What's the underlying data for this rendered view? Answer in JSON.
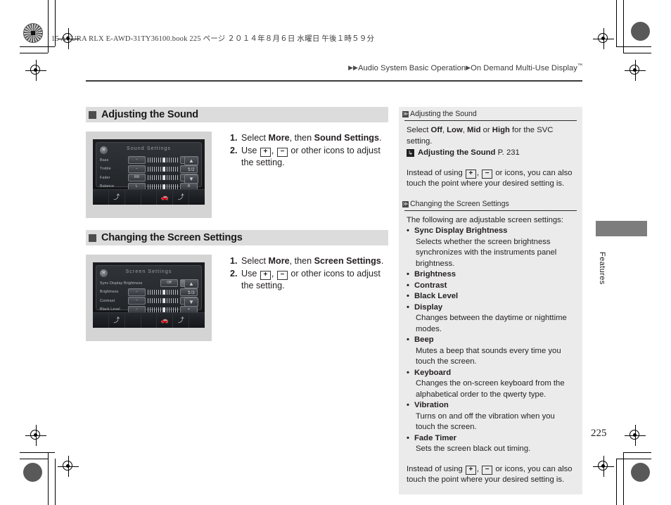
{
  "print_marks": {
    "slugline": "15 ACURA RLX E-AWD-31TY36100.book  225 ページ  ２０１４年８月６日  水曜日  午後１時５９分"
  },
  "header": {
    "breadcrumb_arrow": "▶▶",
    "breadcrumb_1": "Audio System Basic Operation",
    "breadcrumb_sep": "▶",
    "breadcrumb_2": "On Demand Multi-Use Display",
    "trademark": "™"
  },
  "sections": [
    {
      "heading": "Adjusting the Sound",
      "screenshot": {
        "title": "Sound Settings",
        "close_glyph": "✕",
        "page_indicator": "1/2",
        "up_glyph": "▲",
        "down_glyph": "▼",
        "rows": [
          {
            "label": "Bass",
            "left": "−",
            "right": "+",
            "knob": 50
          },
          {
            "label": "Treble",
            "left": "−",
            "right": "+",
            "knob": 50
          },
          {
            "label": "Fader",
            "left": "RR",
            "right": "FR",
            "knob": 50
          },
          {
            "label": "Balance",
            "left": "L",
            "right": "R",
            "knob": 50
          }
        ]
      },
      "steps": [
        {
          "num": "1.",
          "pre": "Select ",
          "b1": "More",
          "mid": ", then ",
          "b2": "Sound Settings",
          "post": "."
        },
        {
          "num": "2.",
          "pre": "Use ",
          "key1": "+",
          "mid": ", ",
          "key2": "−",
          "post": " or other icons to adjust the setting."
        }
      ]
    },
    {
      "heading": "Changing the Screen Settings",
      "screenshot": {
        "title": "Screen Settings",
        "close_glyph": "✕",
        "page_indicator": "1/3",
        "up_glyph": "▲",
        "down_glyph": "▼",
        "rows": [
          {
            "label": "Sync Display Brightness",
            "left": "Off",
            "right": "On",
            "knob": null,
            "toggle": true
          },
          {
            "label": "Brightness",
            "left": "−",
            "right": "+",
            "knob": 50
          },
          {
            "label": "Contrast",
            "left": "−",
            "right": "+",
            "knob": 50
          },
          {
            "label": "Black Level",
            "left": "−",
            "right": "+",
            "knob": 50
          }
        ]
      },
      "steps": [
        {
          "num": "1.",
          "pre": "Select ",
          "b1": "More",
          "mid": ", then ",
          "b2": "Screen Settings",
          "post": "."
        },
        {
          "num": "2.",
          "pre": "Use ",
          "key1": "+",
          "mid": ", ",
          "key2": "−",
          "post": " or other icons to adjust the setting."
        }
      ]
    }
  ],
  "sidebar": {
    "marker_glyph": "≫",
    "block1": {
      "title": "Adjusting the Sound",
      "line1_pre": "Select ",
      "line1_b1": "Off",
      "line1_s1": ", ",
      "line1_b2": "Low",
      "line1_s2": ", ",
      "line1_b3": "Mid",
      "line1_s3": " or ",
      "line1_b4": "High",
      "line1_post": " for the SVC setting.",
      "ref_arrow": "↳",
      "ref_text": "Adjusting the Sound",
      "ref_page": "P. 231",
      "note_pre": "Instead of using ",
      "note_key1": "+",
      "note_mid": ", ",
      "note_key2": "−",
      "note_post": " or icons, you can also touch the point where your desired setting is."
    },
    "block2": {
      "title": "Changing the Screen Settings",
      "intro": "The following are adjustable screen settings:",
      "items": [
        {
          "term": "Sync Display Brightness",
          "desc": "Selects whether the screen brightness synchronizes with the instruments panel brightness."
        },
        {
          "term": "Brightness",
          "desc": ""
        },
        {
          "term": "Contrast",
          "desc": ""
        },
        {
          "term": "Black Level",
          "desc": ""
        },
        {
          "term": "Display",
          "desc": "Changes between the daytime or nighttime modes."
        },
        {
          "term": "Beep",
          "desc": "Mutes a beep that sounds every time you touch the screen."
        },
        {
          "term": "Keyboard",
          "desc": "Changes the on-screen keyboard from the alphabetical order to the qwerty type."
        },
        {
          "term": "Vibration",
          "desc": "Turns on and off the vibration when you touch the screen."
        },
        {
          "term": "Fade Timer",
          "desc": "Sets the screen black out timing."
        }
      ],
      "note_pre": "Instead of using ",
      "note_key1": "+",
      "note_mid": ", ",
      "note_key2": "−",
      "note_post": " or icons, you can also touch the point where your desired setting is."
    }
  },
  "thumb_tab": {
    "label": "Features"
  },
  "page_number": "225",
  "colors": {
    "section_header_bg": "#dcdcdc",
    "sidebar_bg": "#ebebeb",
    "thumb_tab": "#7d7d7d",
    "text": "#231f20"
  }
}
